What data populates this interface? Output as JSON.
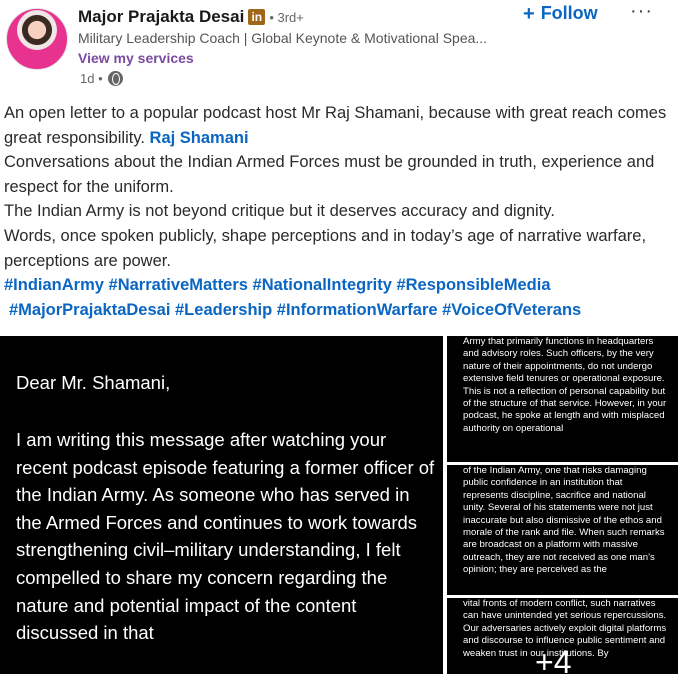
{
  "author": {
    "name": "Major Prajakta Desai",
    "badge": "in",
    "degree": "• 3rd+",
    "headline": "Military Leadership Coach | Global Keynote & Motivational Spea...",
    "services_link": "View my services",
    "time": "1d •"
  },
  "actions": {
    "follow_label": "Follow",
    "follow_icon": "plus-icon",
    "more_label": "···"
  },
  "post": {
    "line1": "An open letter to a popular podcast host Mr Raj Shamani, because with great reach comes great responsibility.",
    "mention": "Raj Shamani",
    "line2": "Conversations about the Indian Armed Forces must be grounded in truth, experience and respect for the uniform.",
    "line3": "The Indian Army is not beyond critique but it deserves accuracy and dignity.",
    "line4": "Words, once spoken publicly, shape perceptions and in today’s age of narrative warfare, perceptions are power.",
    "hashtags_1": "#IndianArmy #NarrativeMatters #NationalIntegrity #ResponsibleMedia",
    "hashtags_2": "#MajorPrajaktaDesai #Leadership #InformationWarfare #VoiceOfVeterans"
  },
  "media": {
    "main_salutation": "Dear Mr. Shamani,",
    "main_text": "I am writing this message after watching your recent podcast episode featuring a former officer of the Indian Army. As someone who has served in the Armed Forces and continues to work towards strengthening civil–military understanding, I felt compelled to share my concern regarding the nature and potential impact of the content discussed in that",
    "thumb1": "Army that primarily functions in headquarters and advisory roles. Such officers, by the very nature of their appointments, do not undergo extensive field tenures or operational exposure. This is not a reflection of personal capability but of the structure of that service. However, in your podcast, he spoke at length and with misplaced authority on operational",
    "thumb2": "of the Indian Army, one that risks damaging public confidence in an institution that represents discipline, sacrifice and national unity. Several of his statements were not just inaccurate but also dismissive of the ethos and morale of the rank and file. When such remarks are broadcast on a platform with massive outreach, they are not received as one man’s opinion; they are perceived as the",
    "thumb3": "vital fronts of modern conflict, such narratives can have unintended yet serious repercussions. Our adversaries actively exploit digital platforms and discourse to influence public sentiment and weaken trust in our institutions. By",
    "more_count": "+4"
  },
  "colors": {
    "link": "#0a66c2",
    "services": "#7a4aa0",
    "media_bg": "#000000"
  }
}
